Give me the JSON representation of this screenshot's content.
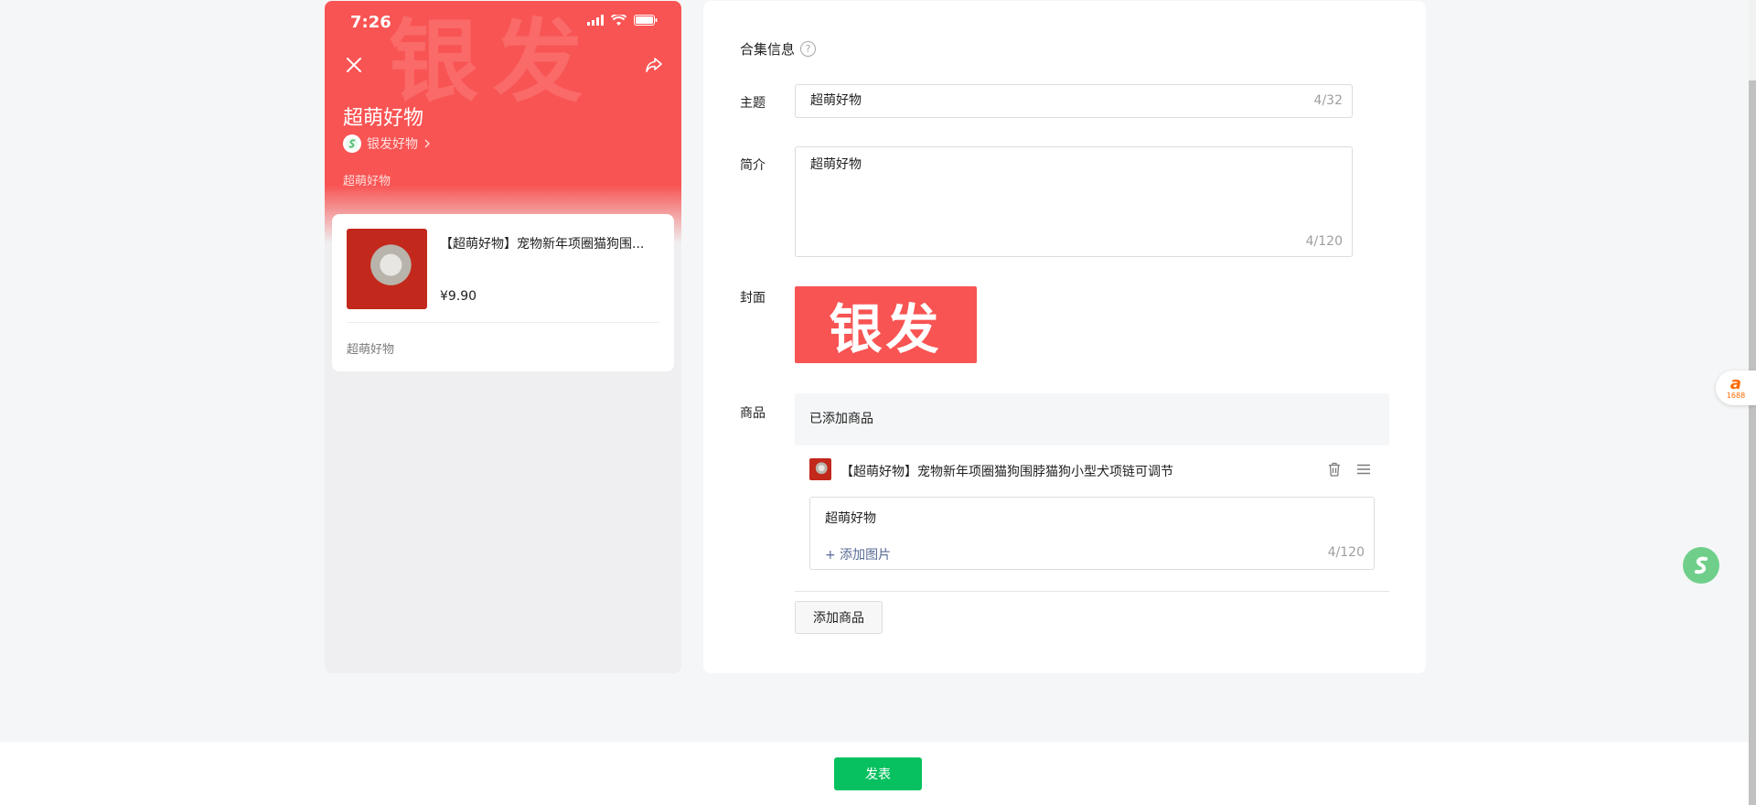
{
  "preview": {
    "status_time": "7:26",
    "watermark": "银发",
    "title": "超萌好物",
    "author": "银发好物",
    "description": "超萌好物",
    "product": {
      "title": "【超萌好物】宠物新年项圈猫狗围...",
      "price": "¥9.90",
      "note": "超萌好物"
    }
  },
  "form": {
    "section_title": "合集信息",
    "help_symbol": "?",
    "theme": {
      "label": "主题",
      "value": "超萌好物",
      "counter": "4/32"
    },
    "intro": {
      "label": "简介",
      "value": "超萌好物",
      "counter": "4/120"
    },
    "cover": {
      "label": "封面",
      "text": "银发"
    },
    "goods": {
      "label": "商品",
      "header": "已添加商品",
      "items": [
        {
          "name": "【超萌好物】宠物新年项圈猫狗围脖猫狗小型犬项链可调节",
          "note": "超萌好物",
          "add_image": "+ 添加图片",
          "counter": "4/120"
        }
      ],
      "add_button": "添加商品"
    }
  },
  "footer": {
    "publish_button": "发表"
  },
  "widgets": {
    "badge_1688_mark": "a",
    "badge_1688_num": "1688"
  },
  "colors": {
    "brand_red": "#f85453",
    "publish_green": "#07c160",
    "link_blue": "#576b95"
  }
}
